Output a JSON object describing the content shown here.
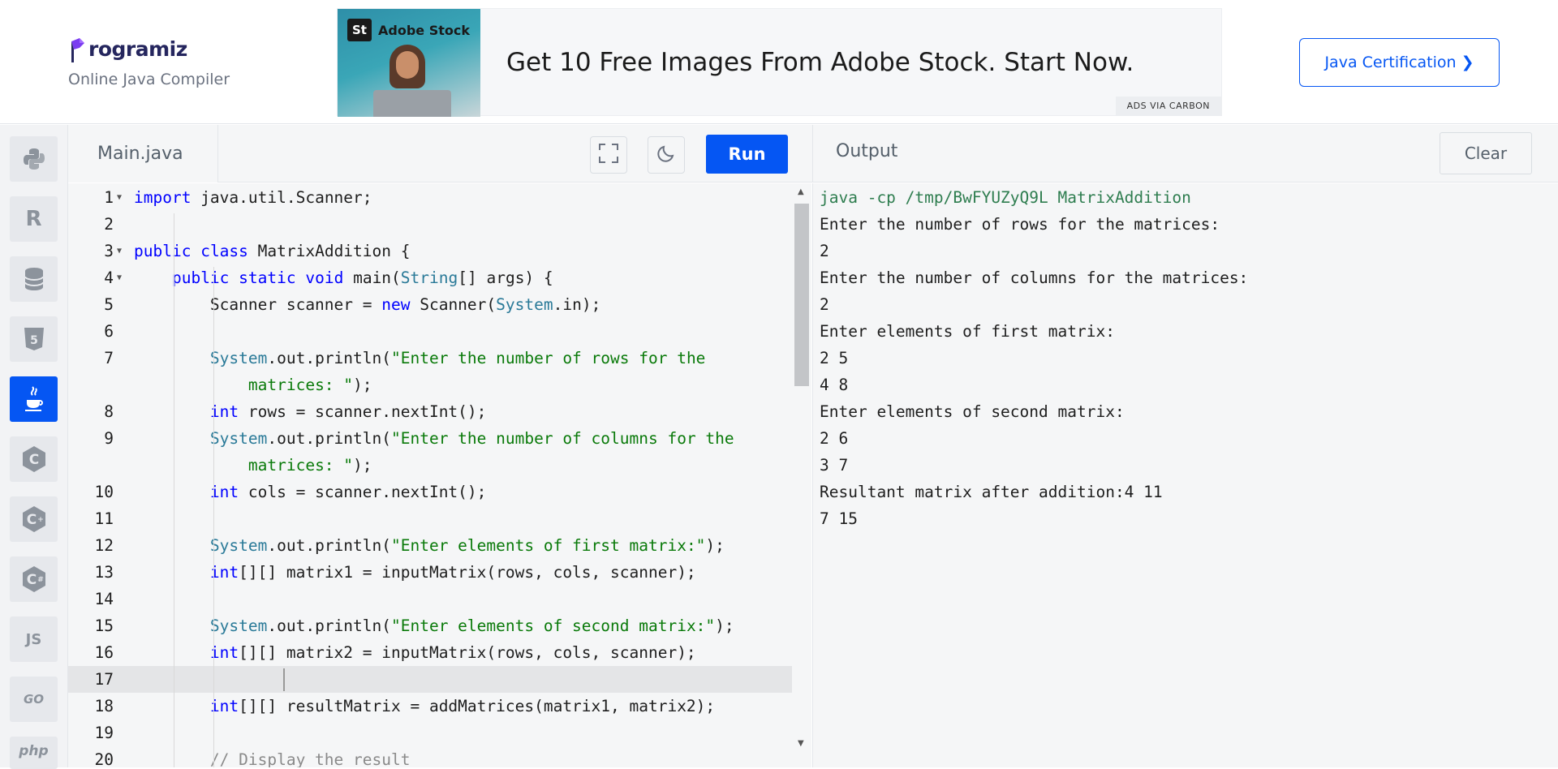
{
  "header": {
    "logo_text": "rogramiz",
    "logo_letter": "P",
    "subtitle": "Online Java Compiler",
    "certification_button": "Java Certification ❯"
  },
  "ad": {
    "brand_badge": "St",
    "brand_name": "Adobe Stock",
    "headline": "Get 10 Free Images From Adobe Stock. Start Now.",
    "attribution": "ADS VIA CARBON"
  },
  "sidebar": {
    "languages": [
      {
        "name": "python",
        "label": ""
      },
      {
        "name": "r",
        "label": "R"
      },
      {
        "name": "sql",
        "label": ""
      },
      {
        "name": "html",
        "label": "5"
      },
      {
        "name": "java",
        "label": ""
      },
      {
        "name": "c",
        "label": "C"
      },
      {
        "name": "cpp",
        "label": "C+"
      },
      {
        "name": "csharp",
        "label": "C#"
      },
      {
        "name": "js",
        "label": "JS"
      },
      {
        "name": "go",
        "label": "GO"
      },
      {
        "name": "php",
        "label": "php"
      }
    ],
    "active": "java"
  },
  "editor": {
    "file_name": "Main.java",
    "run_label": "Run"
  },
  "code_lines": [
    {
      "n": "1",
      "fold": true,
      "html": "<span class=\"kw\">import</span> java.util.Scanner;"
    },
    {
      "n": "2",
      "fold": false,
      "html": ""
    },
    {
      "n": "3",
      "fold": true,
      "html": "<span class=\"kw\">public</span> <span class=\"kw\">class</span> MatrixAddition {"
    },
    {
      "n": "4",
      "fold": true,
      "html": "    <span class=\"kw\">public</span> <span class=\"kw\">static</span> <span class=\"kw\">void</span> main(<span class=\"ty\">String</span>[] args) {"
    },
    {
      "n": "5",
      "fold": false,
      "html": "        Scanner scanner = <span class=\"kw\">new</span> Scanner(<span class=\"ty\">System</span>.in);"
    },
    {
      "n": "6",
      "fold": false,
      "html": ""
    },
    {
      "n": "7",
      "fold": false,
      "html": "        <span class=\"ty\">System</span>.out.println(<span class=\"str\">\"Enter the number of rows for the</span>"
    },
    {
      "n": "",
      "fold": false,
      "html": "            <span class=\"str\">matrices: \"</span>);"
    },
    {
      "n": "8",
      "fold": false,
      "html": "        <span class=\"kw\">int</span> rows = scanner.nextInt();"
    },
    {
      "n": "9",
      "fold": false,
      "html": "        <span class=\"ty\">System</span>.out.println(<span class=\"str\">\"Enter the number of columns for the</span>"
    },
    {
      "n": "",
      "fold": false,
      "html": "            <span class=\"str\">matrices: \"</span>);"
    },
    {
      "n": "10",
      "fold": false,
      "html": "        <span class=\"kw\">int</span> cols = scanner.nextInt();"
    },
    {
      "n": "11",
      "fold": false,
      "html": ""
    },
    {
      "n": "12",
      "fold": false,
      "html": "        <span class=\"ty\">System</span>.out.println(<span class=\"str\">\"Enter elements of first matrix:\"</span>);"
    },
    {
      "n": "13",
      "fold": false,
      "html": "        <span class=\"kw\">int</span>[][] matrix1 = inputMatrix(rows, cols, scanner);"
    },
    {
      "n": "14",
      "fold": false,
      "html": ""
    },
    {
      "n": "15",
      "fold": false,
      "html": "        <span class=\"ty\">System</span>.out.println(<span class=\"str\">\"Enter elements of second matrix:\"</span>);"
    },
    {
      "n": "16",
      "fold": false,
      "html": "        <span class=\"kw\">int</span>[][] matrix2 = inputMatrix(rows, cols, scanner);"
    },
    {
      "n": "17",
      "fold": false,
      "html": "",
      "active": true
    },
    {
      "n": "18",
      "fold": false,
      "html": "        <span class=\"kw\">int</span>[][] resultMatrix = addMatrices(matrix1, matrix2);"
    },
    {
      "n": "19",
      "fold": false,
      "html": ""
    },
    {
      "n": "20",
      "fold": false,
      "html": "        <span class=\"cmt\">// Display the result</span>"
    }
  ],
  "output": {
    "title": "Output",
    "clear_label": "Clear",
    "lines": [
      {
        "text": "java -cp /tmp/BwFYUZyQ9L MatrixAddition",
        "cmd": true
      },
      {
        "text": "Enter the number of rows for the matrices:",
        "cmd": false
      },
      {
        "text": "2",
        "cmd": false
      },
      {
        "text": "Enter the number of columns for the matrices:",
        "cmd": false
      },
      {
        "text": "2",
        "cmd": false
      },
      {
        "text": "Enter elements of first matrix:",
        "cmd": false
      },
      {
        "text": "2 5",
        "cmd": false
      },
      {
        "text": "4 8",
        "cmd": false
      },
      {
        "text": "Enter elements of second matrix:",
        "cmd": false
      },
      {
        "text": "2 6",
        "cmd": false
      },
      {
        "text": "3 7",
        "cmd": false
      },
      {
        "text": "Resultant matrix after addition:4 11",
        "cmd": false
      },
      {
        "text": "7 15",
        "cmd": false
      }
    ]
  },
  "colors": {
    "accent": "#0556f3",
    "keyword": "#0000ff",
    "string": "#0a7a0a",
    "type": "#2a7a98",
    "command": "#2e7d4f"
  }
}
